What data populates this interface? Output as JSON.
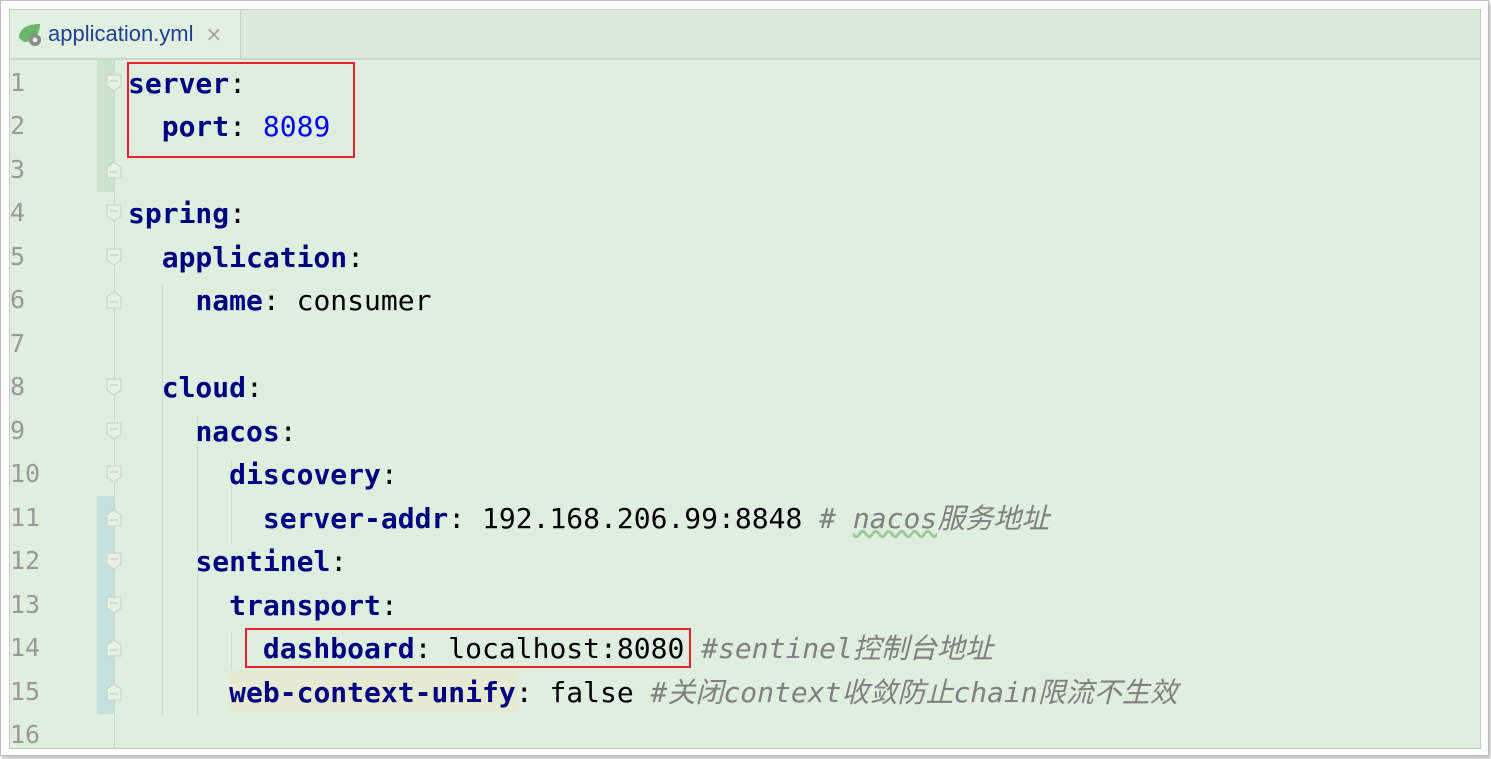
{
  "tab": {
    "label": "application.yml",
    "close": "×",
    "icon": "spring-yaml-file-icon"
  },
  "colors": {
    "key": "#000080",
    "number": "#0000ff",
    "comment": "#808080",
    "highlight_box": "#e8202a",
    "background": "#dfefdf"
  },
  "lines": [
    {
      "no": "1",
      "tokens": [
        {
          "t": "server",
          "c": "k"
        },
        {
          "t": ":",
          "c": "p"
        }
      ]
    },
    {
      "no": "2",
      "tokens": [
        {
          "t": "  "
        },
        {
          "t": "port",
          "c": "k"
        },
        {
          "t": ": ",
          "c": "p"
        },
        {
          "t": "8089",
          "c": "n"
        }
      ]
    },
    {
      "no": "3",
      "tokens": []
    },
    {
      "no": "4",
      "tokens": [
        {
          "t": "spring",
          "c": "k"
        },
        {
          "t": ":",
          "c": "p"
        }
      ]
    },
    {
      "no": "5",
      "tokens": [
        {
          "t": "  "
        },
        {
          "t": "application",
          "c": "k"
        },
        {
          "t": ":",
          "c": "p"
        }
      ]
    },
    {
      "no": "6",
      "tokens": [
        {
          "t": "    "
        },
        {
          "t": "name",
          "c": "k"
        },
        {
          "t": ": consumer",
          "c": "p"
        }
      ]
    },
    {
      "no": "7",
      "tokens": []
    },
    {
      "no": "8",
      "tokens": [
        {
          "t": "  "
        },
        {
          "t": "cloud",
          "c": "k"
        },
        {
          "t": ":",
          "c": "p"
        }
      ]
    },
    {
      "no": "9",
      "tokens": [
        {
          "t": "    "
        },
        {
          "t": "nacos",
          "c": "k"
        },
        {
          "t": ":",
          "c": "p"
        }
      ]
    },
    {
      "no": "10",
      "tokens": [
        {
          "t": "      "
        },
        {
          "t": "discovery",
          "c": "k"
        },
        {
          "t": ":",
          "c": "p"
        }
      ]
    },
    {
      "no": "11",
      "tokens": [
        {
          "t": "        "
        },
        {
          "t": "server-addr",
          "c": "k"
        },
        {
          "t": ": 192.168.206.99:8848 ",
          "c": "p"
        },
        {
          "t": "# ",
          "c": "c"
        },
        {
          "t": "nacos",
          "c": "c squig"
        },
        {
          "t": "服务地址",
          "c": "c"
        }
      ]
    },
    {
      "no": "12",
      "tokens": [
        {
          "t": "    "
        },
        {
          "t": "sentinel",
          "c": "k"
        },
        {
          "t": ":",
          "c": "p"
        }
      ]
    },
    {
      "no": "13",
      "tokens": [
        {
          "t": "      "
        },
        {
          "t": "transport",
          "c": "k"
        },
        {
          "t": ":",
          "c": "p"
        }
      ]
    },
    {
      "no": "14",
      "tokens": [
        {
          "t": "        "
        },
        {
          "t": "dashboard",
          "c": "k"
        },
        {
          "t": ": localhost:8080 ",
          "c": "p"
        },
        {
          "t": "#sentinel控制台地址",
          "c": "c"
        }
      ]
    },
    {
      "no": "15",
      "tokens": [
        {
          "t": "      "
        },
        {
          "t": "web-context-unify",
          "c": "k"
        },
        {
          "t": ": false ",
          "c": "p"
        },
        {
          "t": "#关闭context收敛防止chain限流不生效",
          "c": "c"
        }
      ]
    },
    {
      "no": "16",
      "tokens": []
    }
  ]
}
